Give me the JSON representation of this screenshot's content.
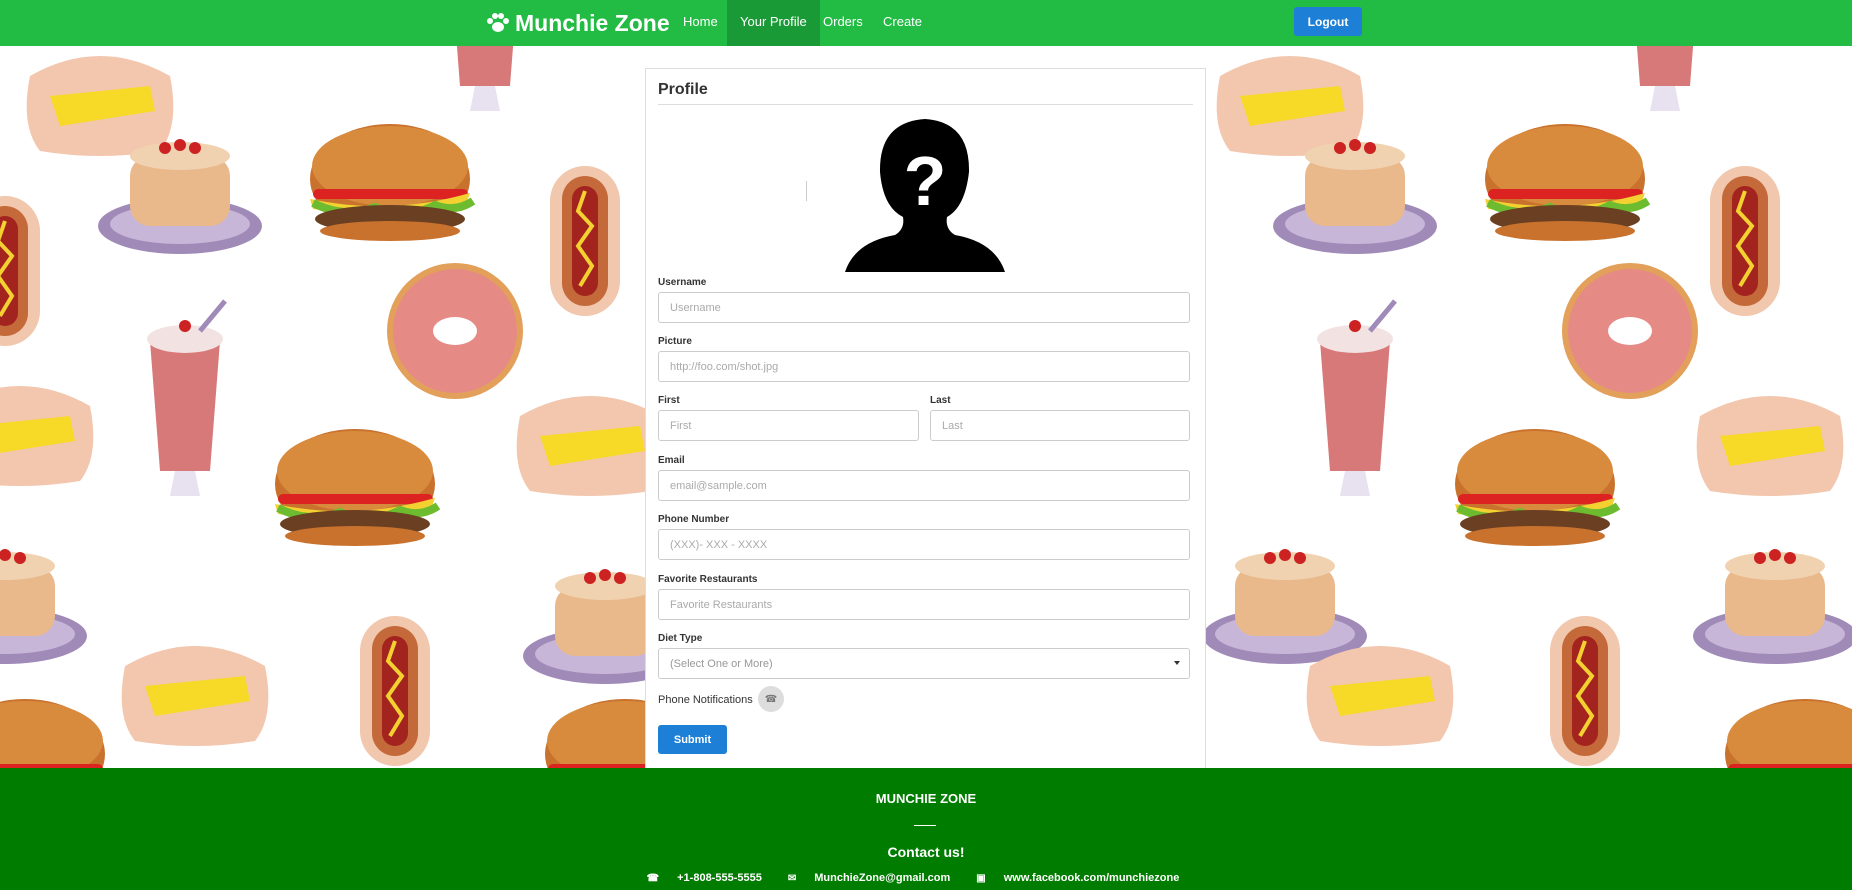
{
  "navbar": {
    "brand": "Munchie Zone",
    "items": [
      {
        "label": "Home"
      },
      {
        "label": "Your Profile"
      },
      {
        "label": "Orders"
      },
      {
        "label": "Create"
      }
    ],
    "logout_label": "Logout",
    "colors": {
      "bar": "#22bb44",
      "active": "#1a9a36",
      "button": "#1e7fd6"
    }
  },
  "profile": {
    "title": "Profile",
    "avatar_icon": "unknown-person-silhouette",
    "username": {
      "label": "Username",
      "placeholder": "Username",
      "value": ""
    },
    "picture": {
      "label": "Picture",
      "placeholder": "http://foo.com/shot.jpg",
      "value": ""
    },
    "first": {
      "label": "First",
      "placeholder": "First",
      "value": ""
    },
    "last": {
      "label": "Last",
      "placeholder": "Last",
      "value": ""
    },
    "email": {
      "label": "Email",
      "placeholder": "email@sample.com",
      "value": ""
    },
    "phone": {
      "label": "Phone Number",
      "placeholder": "(XXX)- XXX - XXXX",
      "value": ""
    },
    "restaurants": {
      "label": "Favorite Restaurants",
      "placeholder": "Favorite Restaurants",
      "value": ""
    },
    "diet": {
      "label": "Diet Type",
      "selected": "(Select One or More)"
    },
    "notifications_label": "Phone Notifications",
    "submit_label": "Submit"
  },
  "footer": {
    "title": "MUNCHIE ZONE",
    "contact_heading": "Contact us!",
    "phone": "+1-808-555-5555",
    "email": "MunchieZone@gmail.com",
    "facebook": "www.facebook.com/munchiezone",
    "bg_color": "#007d00"
  }
}
